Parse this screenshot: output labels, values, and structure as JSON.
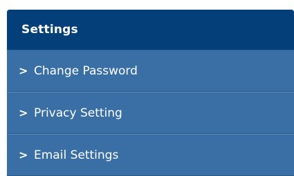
{
  "settings": {
    "title": "Settings",
    "items": [
      {
        "icon": "chevron-right-icon",
        "glyph": ">",
        "label": "Change Password"
      },
      {
        "icon": "chevron-right-icon",
        "glyph": ">",
        "label": "Privacy Setting"
      },
      {
        "icon": "chevron-right-icon",
        "glyph": ">",
        "label": "Email Settings"
      }
    ]
  },
  "colors": {
    "header_bg": "#053f79",
    "item_bg": "#396fa4",
    "text": "#ffffff"
  }
}
